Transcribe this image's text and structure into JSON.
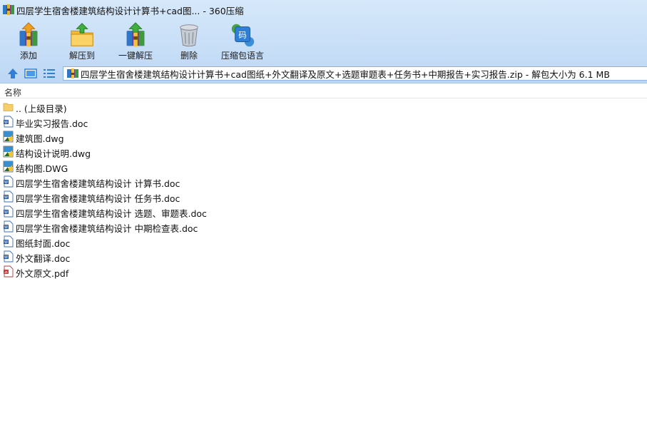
{
  "window": {
    "title": "四层学生宿舍楼建筑结构设计计算书+cad图... - 360压缩"
  },
  "toolbar": {
    "add_label": "添加",
    "extract_label": "解压到",
    "one_click_label": "一键解压",
    "delete_label": "删除",
    "language_label": "压缩包语言",
    "language_badge": "码"
  },
  "address": {
    "path": "四层学生宿舍楼建筑结构设计计算书+cad图纸+外文翻译及原文+选题审题表+任务书+中期报告+实习报告.zip - 解包大小为 6.1 MB"
  },
  "list": {
    "column_name": "名称",
    "files": [
      {
        "name": ".. (上级目录)",
        "icon": "folder-icon"
      },
      {
        "name": "毕业实习报告.doc",
        "icon": "doc-icon"
      },
      {
        "name": "建筑图.dwg",
        "icon": "dwg-icon"
      },
      {
        "name": "结构设计说明.dwg",
        "icon": "dwg-icon"
      },
      {
        "name": "结构图.DWG",
        "icon": "dwg-icon"
      },
      {
        "name": "四层学生宿舍楼建筑结构设计 计算书.doc",
        "icon": "doc-icon"
      },
      {
        "name": "四层学生宿舍楼建筑结构设计 任务书.doc",
        "icon": "doc-icon"
      },
      {
        "name": "四层学生宿舍楼建筑结构设计 选题、审题表.doc",
        "icon": "doc-icon"
      },
      {
        "name": "四层学生宿舍楼建筑结构设计 中期检查表.doc",
        "icon": "doc-icon"
      },
      {
        "name": "图纸封面.doc",
        "icon": "doc-icon"
      },
      {
        "name": "外文翻译.doc",
        "icon": "doc-icon"
      },
      {
        "name": "外文原文.pdf",
        "icon": "pdf-icon"
      }
    ]
  },
  "colors": {
    "chrome_top": "#d6e8fa",
    "chrome_bottom": "#bcd6f3",
    "accent_blue": "#2f7fd6"
  }
}
